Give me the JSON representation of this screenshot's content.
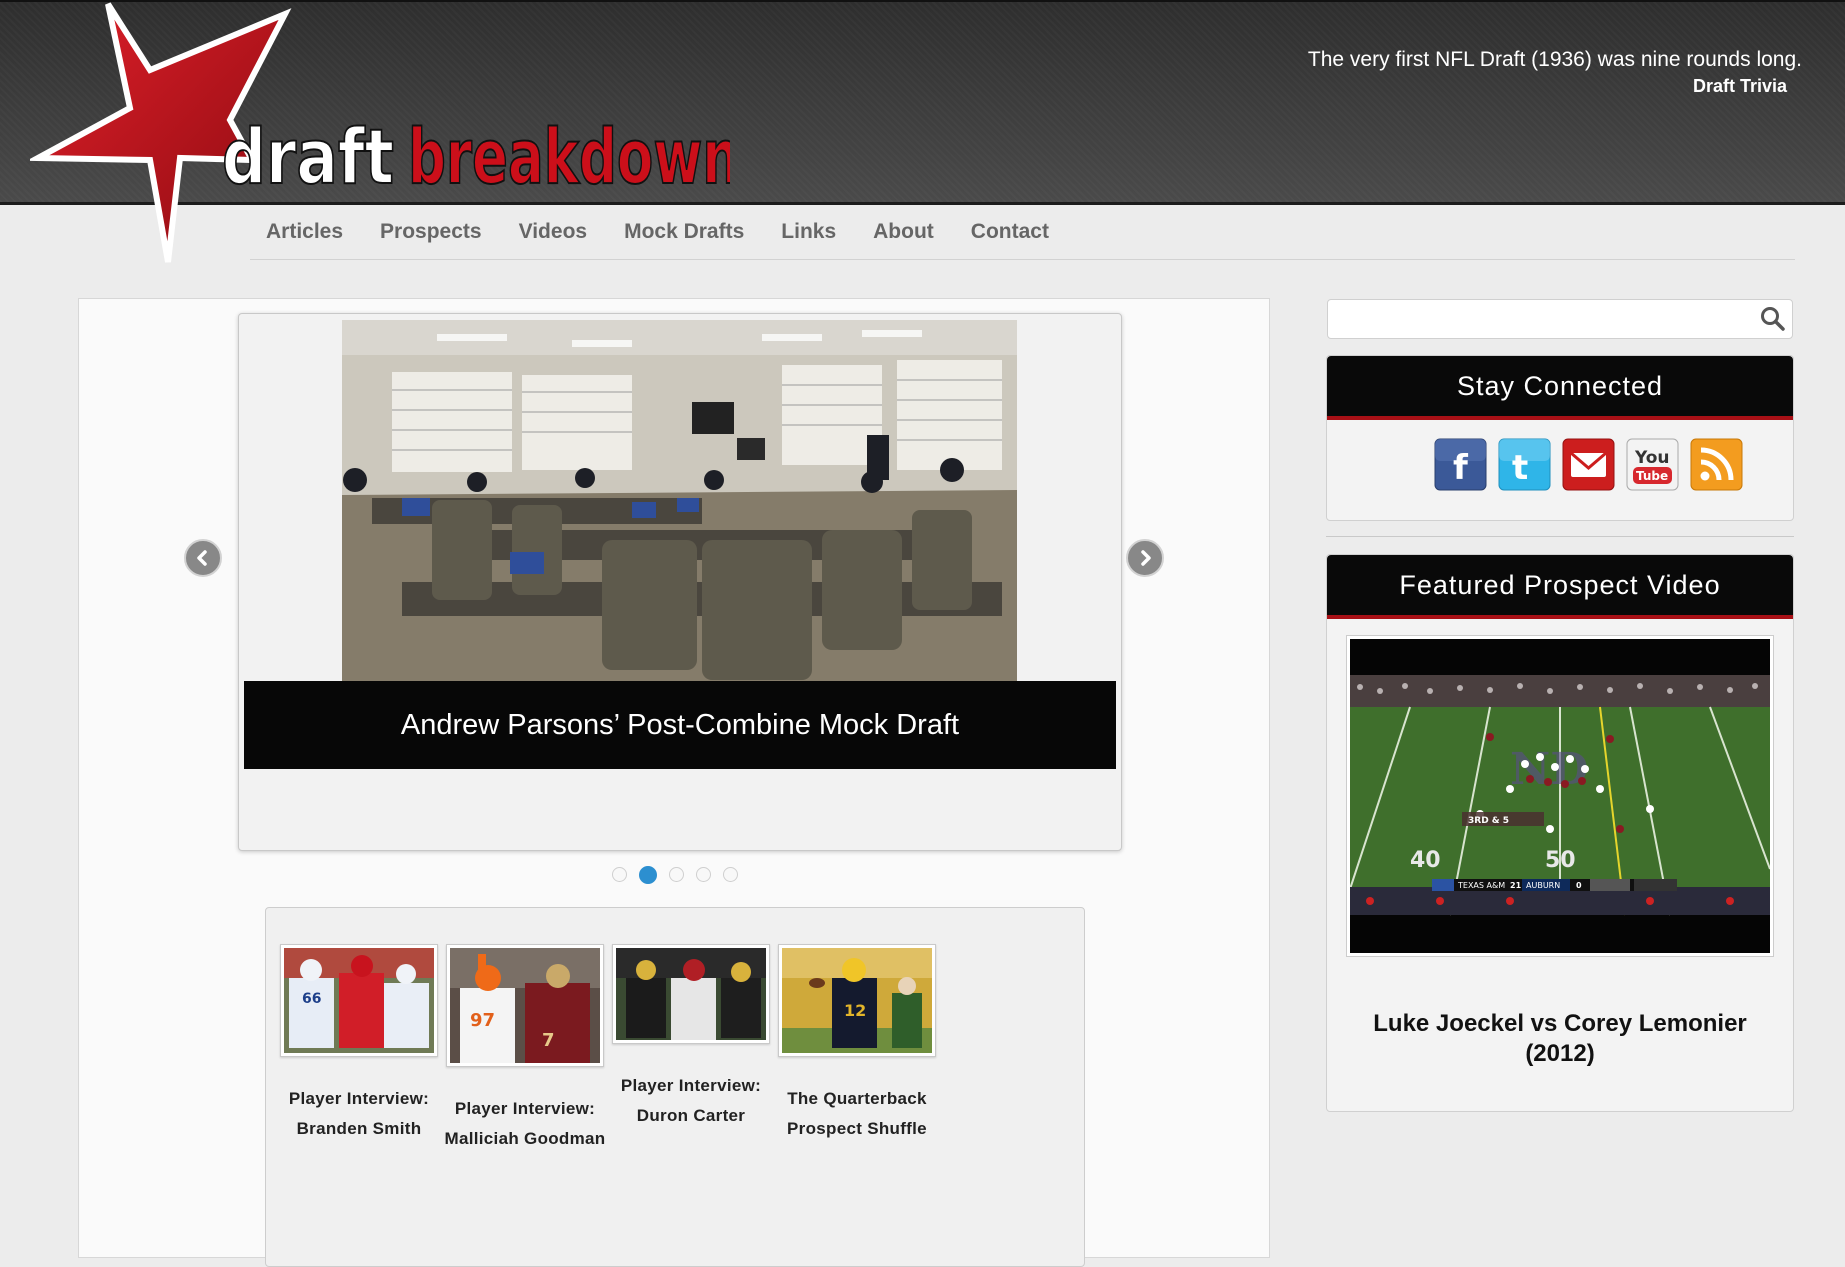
{
  "site": {
    "logo": {
      "word1": "draft",
      "word2": "breakdown"
    }
  },
  "trivia": {
    "text": "The very first NFL Draft (1936) was nine rounds long.",
    "label": "Draft Trivia"
  },
  "nav": {
    "items": [
      "Articles",
      "Prospects",
      "Videos",
      "Mock Drafts",
      "Links",
      "About",
      "Contact"
    ]
  },
  "slider": {
    "caption": "Andrew Parsons’ Post-Combine Mock Draft",
    "dot_count": 5,
    "active_dot": 2
  },
  "thumbnails": [
    {
      "line1": "Player Interview:",
      "line2": "Branden Smith"
    },
    {
      "line1": "Player Interview:",
      "line2": "Malliciah Goodman"
    },
    {
      "line1": "Player Interview:",
      "line2": "Duron Carter"
    },
    {
      "line1": "The Quarterback",
      "line2": "Prospect Shuffle"
    }
  ],
  "search": {
    "placeholder": ""
  },
  "sidebar": {
    "stay_connected": {
      "title": "Stay Connected",
      "icons": [
        "facebook-icon",
        "twitter-icon",
        "email-icon",
        "youtube-icon",
        "rss-icon"
      ],
      "youtube_you": "You",
      "youtube_tube": "Tube"
    },
    "featured_video": {
      "title": "Featured Prospect Video",
      "caption_line1": "Luke Joeckel vs Corey Lemonier",
      "caption_line2": "(2012)",
      "scoreboard": {
        "down": "3RD & 5",
        "team1": "TEXAS A&M",
        "score1": "21",
        "team2": "AUBURN",
        "score2": "0"
      }
    }
  },
  "colors": {
    "accent_red": "#c8101c",
    "header_dark": "#3a3a3a",
    "active_dot": "#2c8fd0"
  }
}
